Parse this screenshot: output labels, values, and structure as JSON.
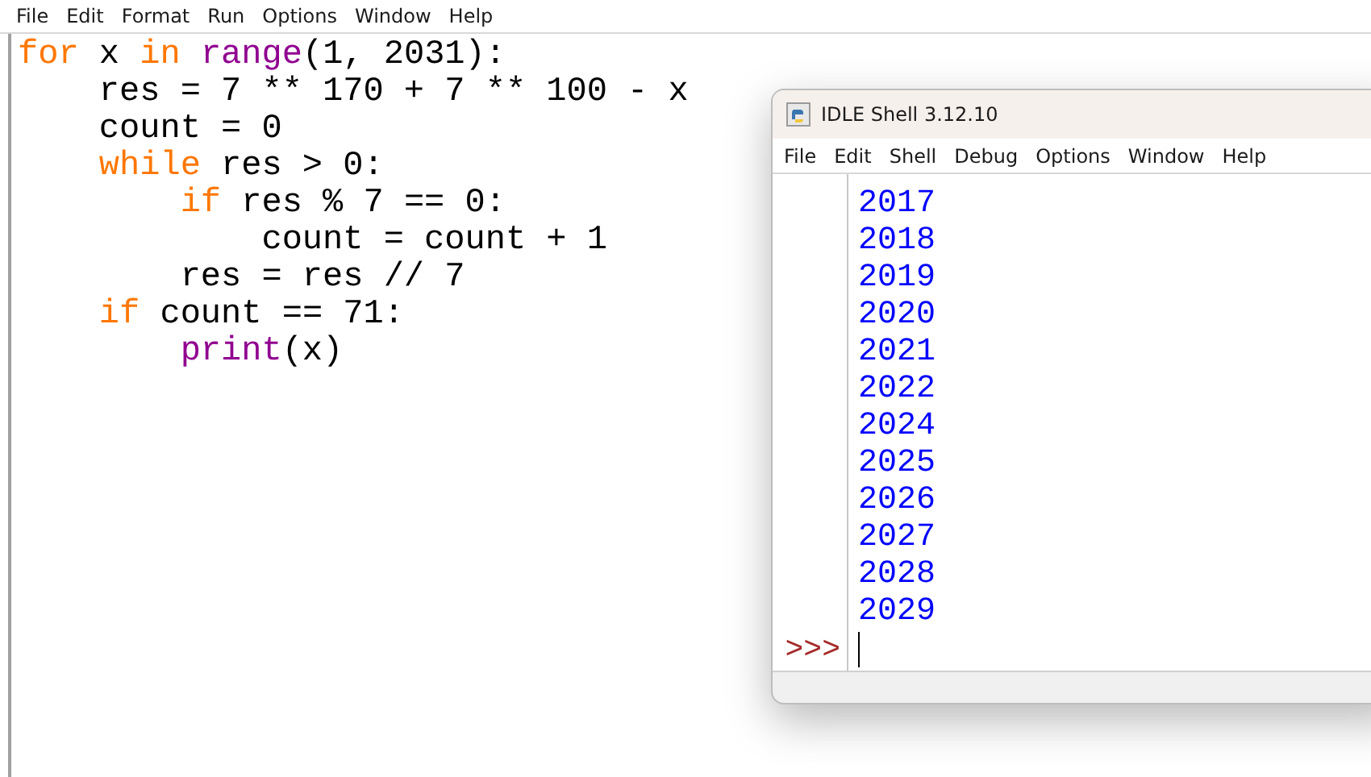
{
  "editor": {
    "menu": [
      "File",
      "Edit",
      "Format",
      "Run",
      "Options",
      "Window",
      "Help"
    ],
    "code": [
      {
        "tokens": [
          {
            "kind": "keyword",
            "text": "for"
          },
          {
            "kind": "plain",
            "text": " x "
          },
          {
            "kind": "keyword",
            "text": "in"
          },
          {
            "kind": "builtin",
            "text": " range"
          },
          {
            "kind": "plain",
            "text": "(1, 2031):"
          }
        ],
        "children": [
          {
            "tokens": [
              {
                "kind": "plain",
                "text": "res = 7 ** 170 + 7 ** 100 - x"
              }
            ]
          },
          {
            "tokens": [
              {
                "kind": "plain",
                "text": "count = 0"
              }
            ]
          },
          {
            "tokens": [
              {
                "kind": "keyword",
                "text": "while"
              },
              {
                "kind": "plain",
                "text": " res > 0:"
              }
            ],
            "children": [
              {
                "tokens": [
                  {
                    "kind": "keyword",
                    "text": "if"
                  },
                  {
                    "kind": "plain",
                    "text": " res % 7 == 0:"
                  }
                ],
                "children": [
                  {
                    "tokens": [
                      {
                        "kind": "plain",
                        "text": "count = count + 1"
                      }
                    ]
                  }
                ]
              },
              {
                "tokens": [
                  {
                    "kind": "plain",
                    "text": "res = res // 7"
                  }
                ]
              }
            ]
          },
          {
            "tokens": [
              {
                "kind": "keyword",
                "text": "if"
              },
              {
                "kind": "plain",
                "text": " count == 71:"
              }
            ],
            "children": [
              {
                "tokens": [
                  {
                    "kind": "builtin",
                    "text": "print"
                  },
                  {
                    "kind": "plain",
                    "text": "(x)"
                  }
                ]
              }
            ]
          }
        ]
      }
    ]
  },
  "shell": {
    "title": "IDLE Shell 3.12.10",
    "menu": [
      "File",
      "Edit",
      "Shell",
      "Debug",
      "Options",
      "Window",
      "Help"
    ],
    "output": [
      "2017",
      "2018",
      "2019",
      "2020",
      "2021",
      "2022",
      "2024",
      "2025",
      "2026",
      "2027",
      "2028",
      "2029"
    ],
    "prompt": ">>>"
  }
}
